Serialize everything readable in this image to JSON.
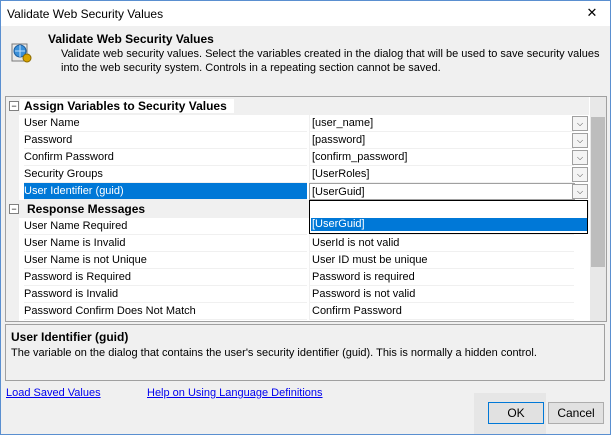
{
  "window": {
    "title": "Validate Web Security Values",
    "close_glyph": "✕"
  },
  "header": {
    "title": "Validate Web Security Values",
    "description": "Validate web security values. Select the variables created in the dialog that will be used to save security values into the web security system.  Controls in a repeating section cannot be saved.",
    "icon": "web-globe-icon"
  },
  "grid": {
    "categories": [
      {
        "label": "Assign Variables to Security Values",
        "toggle": "⊟"
      },
      {
        "label": "Response Messages",
        "toggle": "⊟"
      }
    ],
    "assign_rows": [
      {
        "name": "User Name",
        "value": "[user_name]"
      },
      {
        "name": "Password",
        "value": "[password]"
      },
      {
        "name": "Confirm Password",
        "value": "[confirm_password]"
      },
      {
        "name": "Security Groups",
        "value": "[UserRoles]"
      },
      {
        "name": "User Identifier (guid)",
        "value": "[UserGuid]"
      }
    ],
    "response_rows": [
      {
        "name": "User Name Required",
        "value": ""
      },
      {
        "name": "User Name is Invalid",
        "value": "UserId is not valid"
      },
      {
        "name": "User Name is not Unique",
        "value": "User ID must be unique"
      },
      {
        "name": "Password is Required",
        "value": "Password is required"
      },
      {
        "name": "Password is Invalid",
        "value": "Password is not valid"
      },
      {
        "name": "Password Confirm Does Not Match",
        "value": "Confirm Password"
      }
    ],
    "dropdown_options": [
      "",
      "[UserGuid]"
    ],
    "dropdown_glyph": "⌵"
  },
  "help": {
    "title": "User Identifier (guid)",
    "description": "The variable on the dialog that contains the user's security identifier (guid).  This is normally a hidden control."
  },
  "footer": {
    "load_link": "Load Saved Values",
    "help_link": "Help on Using Language Definitions",
    "ok": "OK",
    "cancel": "Cancel"
  },
  "colors": {
    "selection": "#0078d7",
    "link": "#0000ee"
  }
}
